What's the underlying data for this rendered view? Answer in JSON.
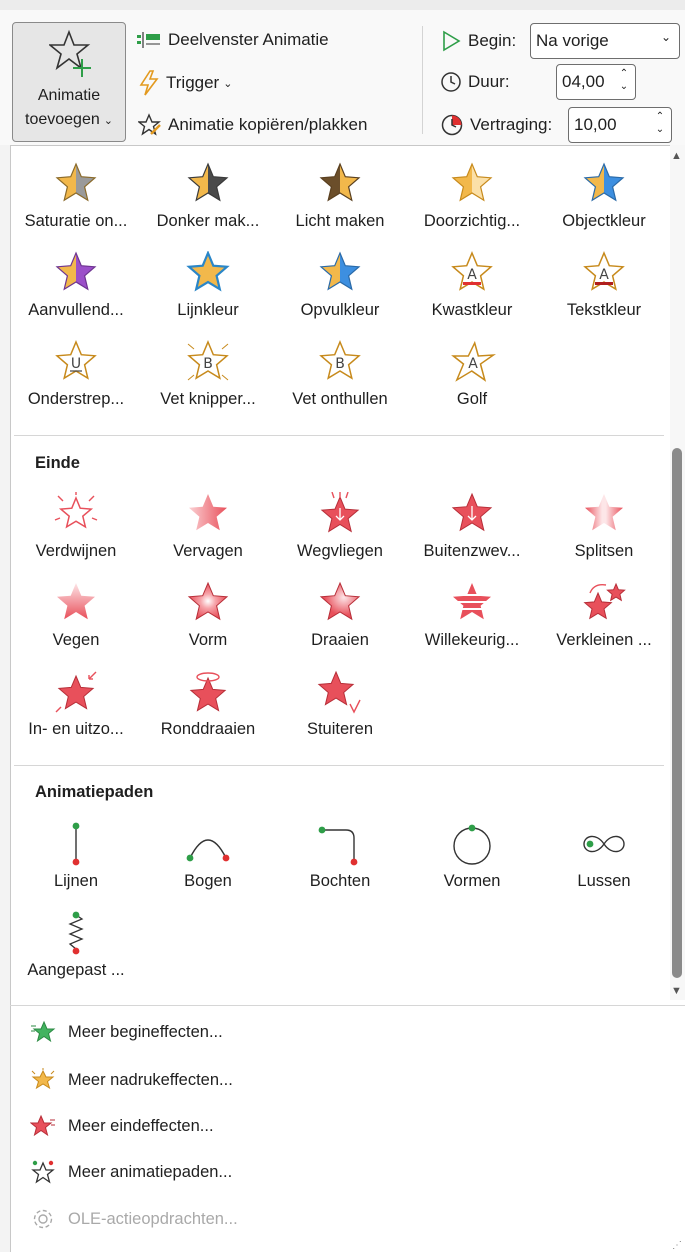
{
  "ribbon": {
    "add_animation_line1": "Animatie",
    "add_animation_line2": "toevoegen",
    "animation_pane": "Deelvenster Animatie",
    "trigger": "Trigger",
    "copy_animation": "Animatie kopiëren/plakken",
    "begin_label": "Begin:",
    "begin_value": "Na vorige",
    "duration_label": "Duur:",
    "duration_value": "04,00",
    "delay_label": "Vertraging:",
    "delay_value": "10,00"
  },
  "emphasis": [
    {
      "label": "Saturatie on...",
      "icon": "star-desaturate-icon"
    },
    {
      "label": "Donker mak...",
      "icon": "star-darken-icon"
    },
    {
      "label": "Licht maken",
      "icon": "star-lighten-icon"
    },
    {
      "label": "Doorzichtig...",
      "icon": "star-transparency-icon"
    },
    {
      "label": "Objectkleur",
      "icon": "star-object-color-icon"
    },
    {
      "label": "Aanvullend...",
      "icon": "star-complementary-icon"
    },
    {
      "label": "Lijnkleur",
      "icon": "star-line-color-icon"
    },
    {
      "label": "Opvulkleur",
      "icon": "star-fill-color-icon"
    },
    {
      "label": "Kwastkleur",
      "icon": "star-brush-color-icon"
    },
    {
      "label": "Tekstkleur",
      "icon": "star-font-color-icon"
    },
    {
      "label": "Onderstrep...",
      "icon": "star-underline-icon"
    },
    {
      "label": "Vet knipper...",
      "icon": "star-bold-flash-icon"
    },
    {
      "label": "Vet onthullen",
      "icon": "star-bold-reveal-icon"
    },
    {
      "label": "Golf",
      "icon": "star-wave-icon"
    }
  ],
  "exit_title": "Einde",
  "exit": [
    {
      "label": "Verdwijnen",
      "icon": "star-disappear-icon"
    },
    {
      "label": "Vervagen",
      "icon": "star-fade-icon"
    },
    {
      "label": "Wegvliegen",
      "icon": "star-fly-out-icon"
    },
    {
      "label": "Buitenzwev...",
      "icon": "star-float-out-icon"
    },
    {
      "label": "Splitsen",
      "icon": "star-split-icon"
    },
    {
      "label": "Vegen",
      "icon": "star-wipe-icon"
    },
    {
      "label": "Vorm",
      "icon": "star-shape-icon"
    },
    {
      "label": "Draaien",
      "icon": "star-wheel-icon"
    },
    {
      "label": "Willekeurig...",
      "icon": "star-random-bars-icon"
    },
    {
      "label": "Verkleinen ...",
      "icon": "star-shrink-turn-icon"
    },
    {
      "label": "In- en uitzo...",
      "icon": "star-zoom-icon"
    },
    {
      "label": "Ronddraaien",
      "icon": "star-swivel-icon"
    },
    {
      "label": "Stuiteren",
      "icon": "star-bounce-icon"
    }
  ],
  "paths_title": "Animatiepaden",
  "paths": [
    {
      "label": "Lijnen",
      "icon": "path-lines-icon"
    },
    {
      "label": "Bogen",
      "icon": "path-arcs-icon"
    },
    {
      "label": "Bochten",
      "icon": "path-turns-icon"
    },
    {
      "label": "Vormen",
      "icon": "path-shapes-icon"
    },
    {
      "label": "Lussen",
      "icon": "path-loops-icon"
    },
    {
      "label": "Aangepast ...",
      "icon": "path-custom-icon"
    }
  ],
  "more": {
    "entrance": "Meer begineffecten...",
    "emphasis": "Meer nadrukeffecten...",
    "exit": "Meer eindeffecten...",
    "paths": "Meer animatiepaden...",
    "ole": "OLE-actieopdrachten..."
  },
  "colors": {
    "exit_red": "#e8505b",
    "emphasis_gold": "#f2b84b",
    "entrance_green": "#43b360",
    "path_green": "#2e9e48",
    "path_red": "#e03030"
  }
}
